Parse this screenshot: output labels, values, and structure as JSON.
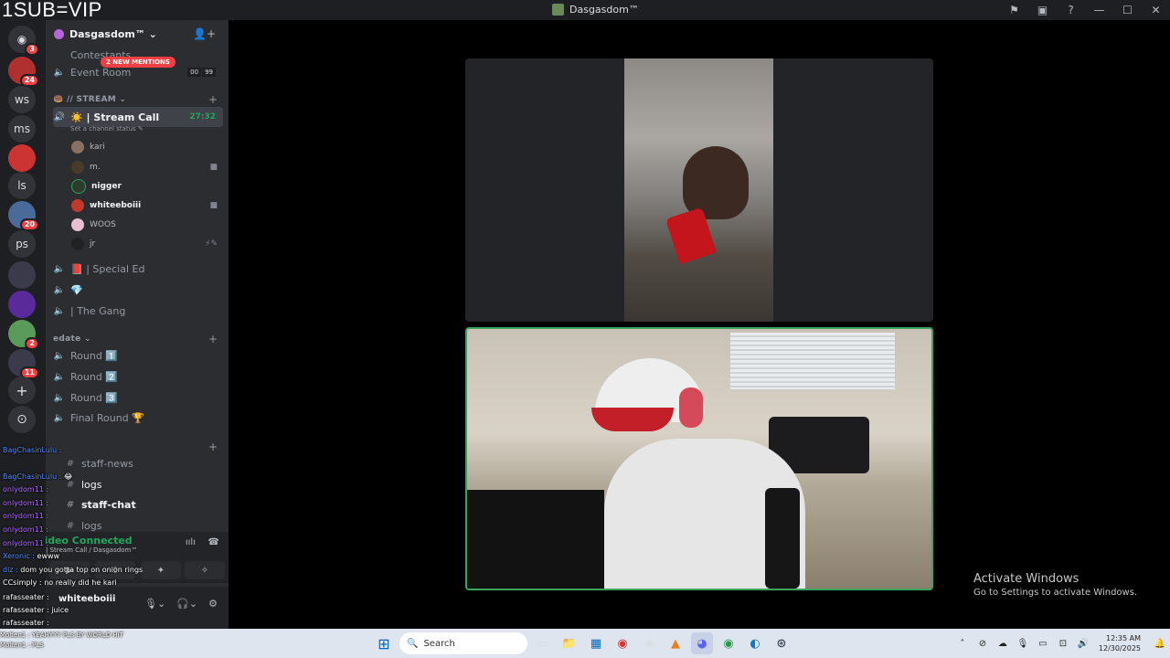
{
  "overlay": {
    "text": "1SUB=VIP"
  },
  "window": {
    "title": "Dasgasdom™",
    "icons": [
      "flag-icon",
      "monitor-icon",
      "help-icon",
      "minimize-icon",
      "maximize-icon",
      "close-icon"
    ]
  },
  "servers": [
    {
      "label": "",
      "badge": "3",
      "icon": "discord-home-icon"
    },
    {
      "label": "",
      "badge": "24",
      "icon": "server-red-icon"
    },
    {
      "label": "ws",
      "badge": ""
    },
    {
      "label": "ms",
      "badge": ""
    },
    {
      "label": "",
      "badge": "",
      "icon": "server-redlogo-icon"
    },
    {
      "label": "ls",
      "badge": ""
    },
    {
      "label": "",
      "badge": "20",
      "icon": "server-voice-icon"
    },
    {
      "label": "ps",
      "badge": ""
    },
    {
      "label": "",
      "badge": "",
      "icon": "server-geek-icon"
    },
    {
      "label": "",
      "badge": "",
      "icon": "server-purple-icon"
    },
    {
      "label": "",
      "badge": "2",
      "icon": "server-green-icon"
    },
    {
      "label": "",
      "badge": "11",
      "icon": "server-geek2-icon"
    },
    {
      "label": "+",
      "badge": "",
      "icon": "add-server-icon"
    },
    {
      "label": "⊙",
      "badge": "",
      "icon": "discover-icon"
    }
  ],
  "guild": {
    "name": "Dasgasdom™ ⌄"
  },
  "channels": {
    "contestants": "Contestants",
    "mentions": "2 NEW MENTIONS",
    "event_room": "Event Room",
    "event_counter": [
      "00",
      "99"
    ],
    "stream_category": "// STREAM ⌄",
    "stream_call": "☀️ | Stream Call",
    "stream_timer": "27:32",
    "status_placeholder": "Set a channel status ✎",
    "members": [
      {
        "name": "kari",
        "bold": false,
        "cam": ""
      },
      {
        "name": "m.",
        "bold": false,
        "cam": "■"
      },
      {
        "name": "nigger",
        "bold": true,
        "cam": ""
      },
      {
        "name": "whiteeboiii",
        "bold": true,
        "cam": "■"
      },
      {
        "name": "WOOS",
        "bold": false,
        "cam": ""
      },
      {
        "name": "jr",
        "bold": false,
        "cam": "⚡✎"
      }
    ],
    "special_ed": "📕 | Special Ed",
    "gem": "💎",
    "the_gang": "| The Gang",
    "edate_category": "edate ⌄",
    "rounds": [
      "Round 1️⃣",
      "Round 2️⃣",
      "Round 3️⃣",
      "Final Round 🏆"
    ],
    "staff_news": "staff-news",
    "logs": "logs",
    "staff_chat": "staff-chat",
    "logs2": "logs"
  },
  "voice": {
    "connected": "Video Connected",
    "location": "| Stream Call / Dasgasdom™"
  },
  "user": {
    "name": "whiteeboiii"
  },
  "chat_overlay": [
    {
      "name": "BagChasinLulu :",
      "text": "",
      "color": "n-blue"
    },
    {
      "name": "BagChasinLulu :",
      "text": "😂",
      "color": "n-blue"
    },
    {
      "name": "onlydom11 :",
      "text": "",
      "color": "n-purple"
    },
    {
      "name": "onlydom11 :",
      "text": "",
      "color": "n-purple"
    },
    {
      "name": "onlydom11 :",
      "text": "",
      "color": "n-purple"
    },
    {
      "name": "onlydom11 :",
      "text": "",
      "color": "n-purple"
    },
    {
      "name": "onlydom11 :",
      "text": "",
      "color": "n-purple"
    },
    {
      "name": "Xeronic :",
      "text": "ewww",
      "color": "n-blue"
    },
    {
      "name": "diz :",
      "text": "dom you gotta top on onion rings",
      "color": "n-blue"
    },
    {
      "name": "CCsimply :",
      "text": "no really did he kari",
      "color": "n-white"
    },
    {
      "name": "rafasseater :",
      "text": "",
      "color": "n-white"
    },
    {
      "name": "rafasseater :",
      "text": "juice",
      "color": "n-white"
    },
    {
      "name": "rafasseater :",
      "text": "",
      "color": "n-white"
    }
  ],
  "taskbar_chat": [
    "Molten1 : YEAHYYY PLS BY WORLD HIT",
    "Molten1 : PLS"
  ],
  "activate": {
    "line1": "Activate Windows",
    "line2": "Go to Settings to activate Windows."
  },
  "taskbar": {
    "search": "Search",
    "time": "12:35 AM",
    "date": "12/30/2025"
  }
}
